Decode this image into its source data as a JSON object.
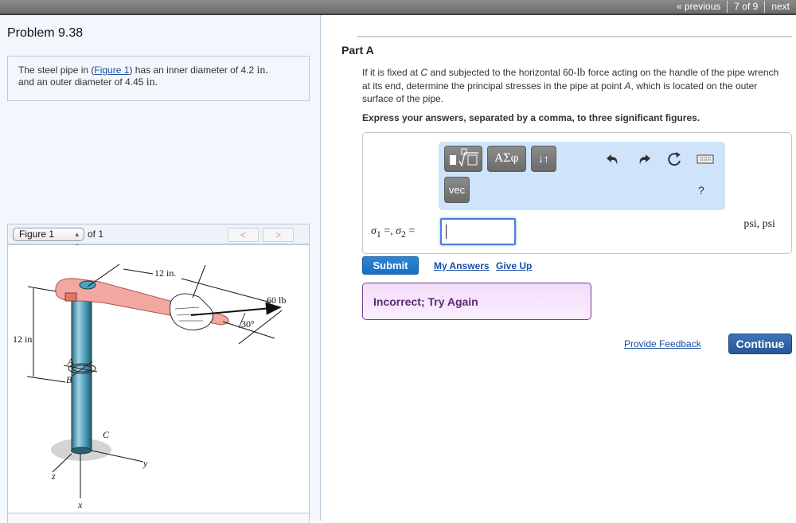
{
  "topnav": {
    "previous": "« previous",
    "position": "7 of 9",
    "next": "next"
  },
  "problem": {
    "title": "Problem 9.38",
    "text_1": "The steel pipe in (",
    "figure_link": "Figure 1",
    "text_2": ") has an inner diameter of 4.2 ",
    "unit_in_1": "in.",
    "text_3": " and an outer diameter of 4.45 ",
    "unit_in_2": "in."
  },
  "figure": {
    "select_value": "Figure 1",
    "of_label": "of 1",
    "prev_icon": "chevron-left",
    "next_icon": "chevron-right",
    "labels": {
      "len_handle": "12 in.",
      "force": "60 lb",
      "angle": "30°",
      "len_height": "12 in.",
      "A": "A",
      "B": "B",
      "C": "C",
      "x": "x",
      "y": "y",
      "z": "z"
    }
  },
  "part": {
    "title": "Part A",
    "question_1": "If it is fixed at ",
    "question_C": "C",
    "question_2": " and subjected to the horizontal 60-",
    "question_lb": "lb",
    "question_3": " force acting on the handle of the pipe wrench at its end, determine the principal stresses in the pipe at point ",
    "question_A": "A",
    "question_4": ", which is located on the outer surface of the pipe.",
    "instruction": "Express your answers, separated by a comma, to three significant figures."
  },
  "toolbar": {
    "template_glyph": "■∜□",
    "greek": "ΑΣφ",
    "updown": "↓↑",
    "vec": "vec",
    "undo_glyph": "↶",
    "redo_glyph": "↷",
    "reset_glyph": "↻",
    "keyboard_glyph": "⌨",
    "help": "?"
  },
  "answer": {
    "label_sigma1": "σ",
    "sub1": "1",
    "label_eq1": " =, ",
    "label_sigma2": "σ",
    "sub2": "2",
    "label_eq2": " =",
    "value": "",
    "units": "psi,  psi"
  },
  "actions": {
    "submit": "Submit",
    "my_answers": "My Answers",
    "give_up": "Give Up",
    "feedback_message": "Incorrect; Try Again",
    "provide_feedback": "Provide Feedback",
    "continue": "Continue"
  }
}
